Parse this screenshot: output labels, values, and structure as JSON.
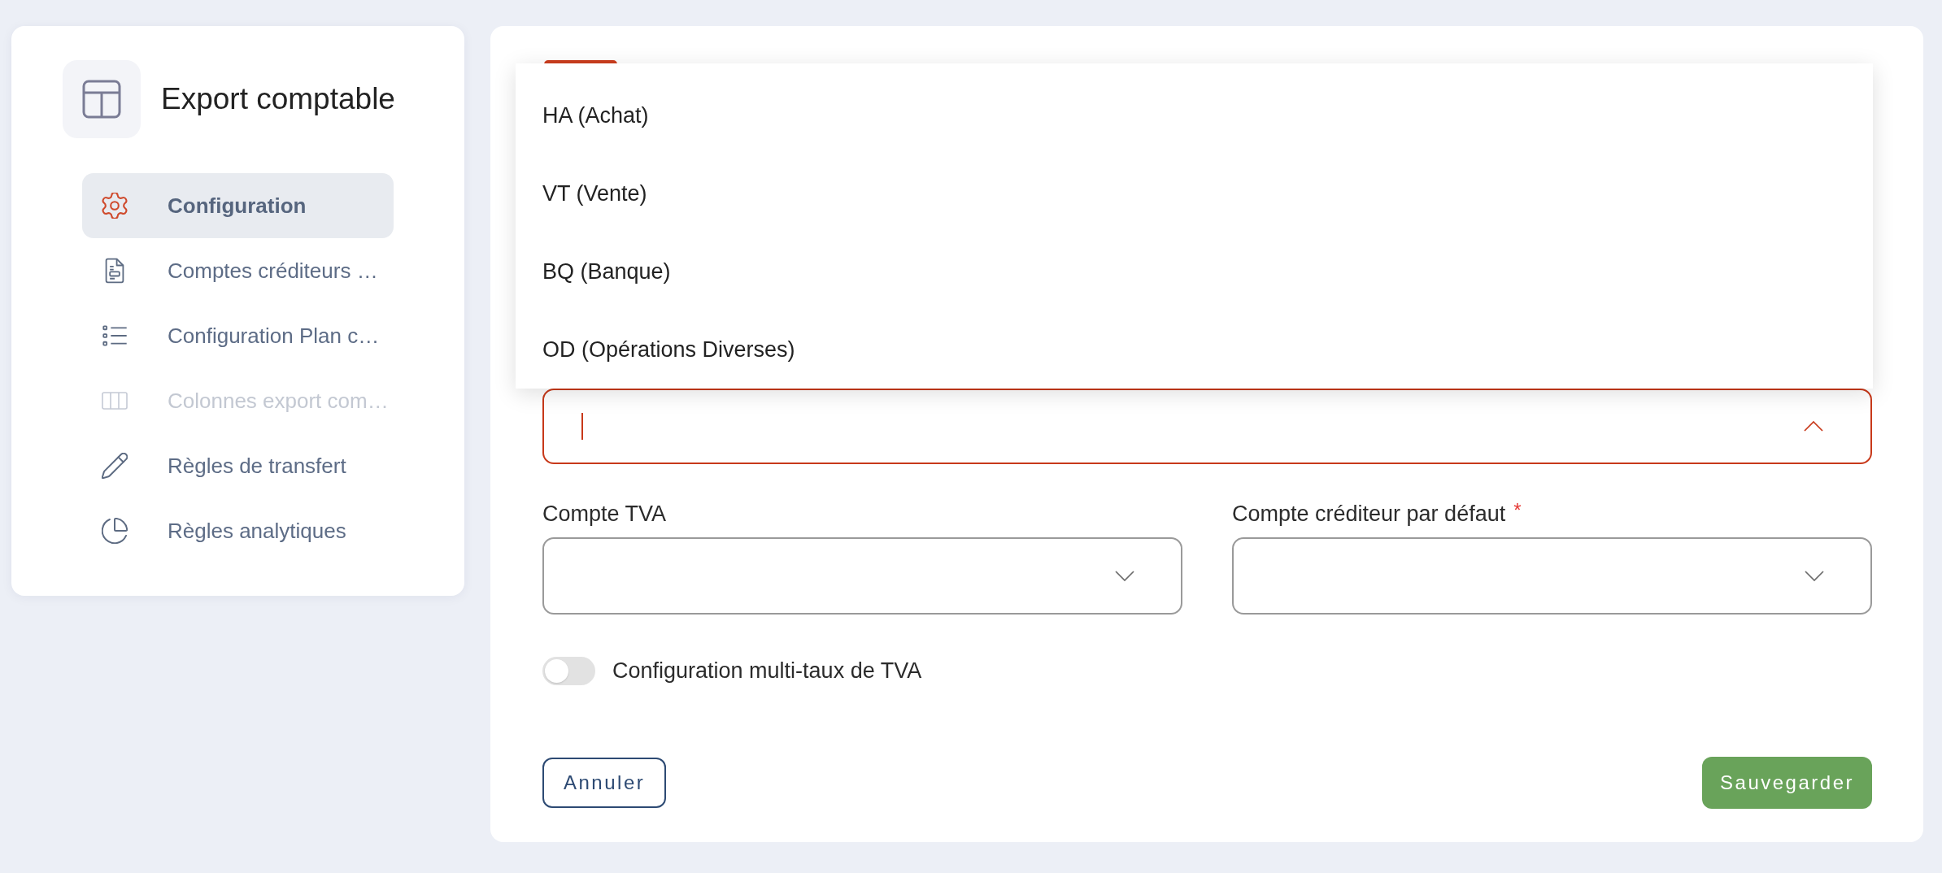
{
  "sidebar": {
    "title": "Export comptable",
    "items": [
      {
        "label": "Configuration",
        "selected": true,
        "disabled": false
      },
      {
        "label": "Comptes créditeurs …",
        "selected": false,
        "disabled": false
      },
      {
        "label": "Configuration Plan c…",
        "selected": false,
        "disabled": false
      },
      {
        "label": "Colonnes export com…",
        "selected": false,
        "disabled": true
      },
      {
        "label": "Règles de transfert",
        "selected": false,
        "disabled": false
      },
      {
        "label": "Règles analytiques",
        "selected": false,
        "disabled": false
      }
    ]
  },
  "form": {
    "journal_select": {
      "focused": true,
      "expanded": true,
      "options": [
        {
          "label": "HA (Achat)",
          "selected": false
        },
        {
          "label": "VT (Vente)",
          "selected": false
        },
        {
          "label": "BQ (Banque)",
          "selected": false
        },
        {
          "label": "OD (Opérations Diverses)",
          "selected": false
        }
      ]
    },
    "fields": [
      {
        "label": "Compte TVA"
      },
      {
        "label": "Compte créditeur par défaut",
        "required_mark": "*"
      }
    ],
    "toggle": {
      "label": "Configuration multi-taux de TVA",
      "on": false
    },
    "buttons": [
      {
        "label": "Annuler",
        "kind": "secondary"
      },
      {
        "label": "Sauvegarder",
        "kind": "primary"
      }
    ]
  }
}
